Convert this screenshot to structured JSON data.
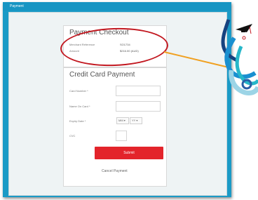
{
  "window": {
    "title": "Payment"
  },
  "checkout": {
    "title": "Payment Checkout",
    "merchant_label": "Merchant Reference",
    "merchant_value": "SO1734",
    "amount_label": "Amount",
    "amount_value": "$216.00 (AUD)"
  },
  "card": {
    "title": "Credit Card Payment",
    "number_label": "Card Number *",
    "name_label": "Name On Card *",
    "expiry_label": "Expiry Date *",
    "month_value": "MM",
    "year_value": "YY",
    "cvc_label": "CVC",
    "submit_label": "Submit",
    "cancel_label": "Cancel Payment"
  },
  "colors": {
    "window_blue": "#1a9ac6",
    "submit_red": "#e3242b",
    "highlight_red": "#c21820",
    "connector_orange": "#f0a020"
  },
  "decor": {
    "icon": "graduate-fish-mascot-icon"
  }
}
